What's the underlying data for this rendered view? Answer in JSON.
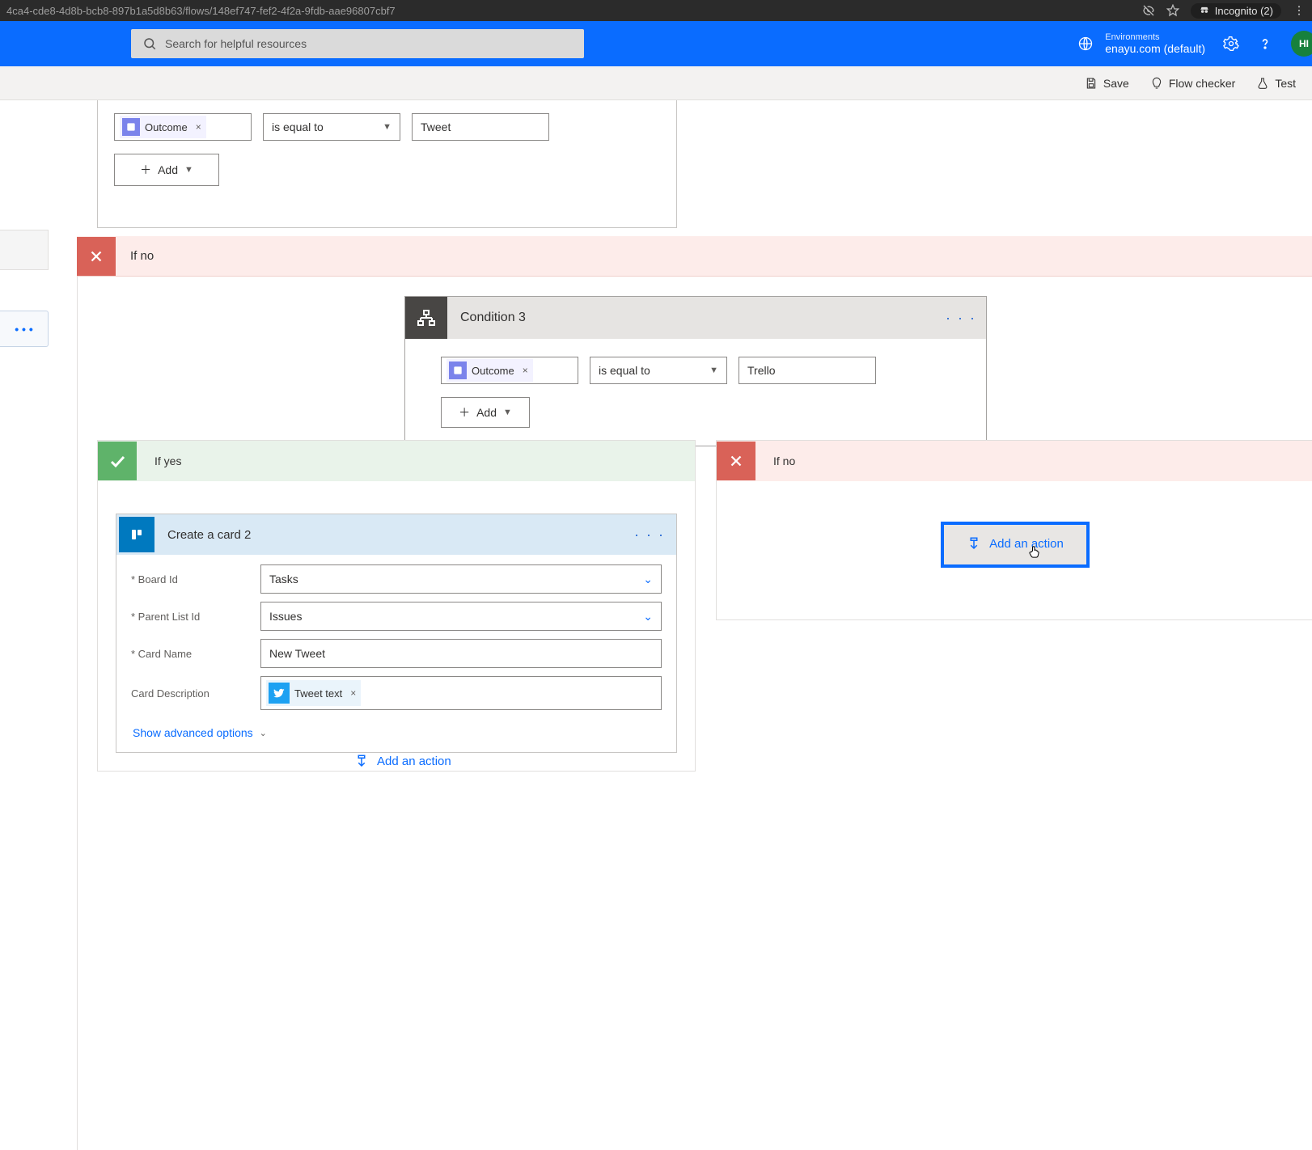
{
  "browser": {
    "url": "4ca4-cde8-4d8b-bcb8-897b1a5d8b63/flows/148ef747-fef2-4f2a-9fdb-aae96807cbf7",
    "incognito_label": "Incognito (2)"
  },
  "header": {
    "search_placeholder": "Search for helpful resources",
    "env_label": "Environments",
    "env_name": "enayu.com (default)",
    "avatar_initials": "HI"
  },
  "toolbar": {
    "save": "Save",
    "flow_checker": "Flow checker",
    "test": "Test"
  },
  "top_condition": {
    "token_label": "Outcome",
    "operator": "is equal to",
    "value": "Tweet",
    "add_label": "Add"
  },
  "branch": {
    "if_no": "If no",
    "if_yes": "If yes"
  },
  "condition3": {
    "title": "Condition 3",
    "token_label": "Outcome",
    "operator": "is equal to",
    "value": "Trello",
    "add_label": "Add"
  },
  "trello_card": {
    "title": "Create a card 2",
    "fields": {
      "board_id_label": "Board Id",
      "board_id_value": "Tasks",
      "parent_list_label": "Parent List Id",
      "parent_list_value": "Issues",
      "card_name_label": "Card Name",
      "card_name_value": "New Tweet",
      "card_desc_label": "Card Description",
      "card_desc_token": "Tweet text"
    },
    "advanced": "Show advanced options"
  },
  "actions": {
    "add_an_action": "Add an action"
  },
  "left_chip": "• • •"
}
